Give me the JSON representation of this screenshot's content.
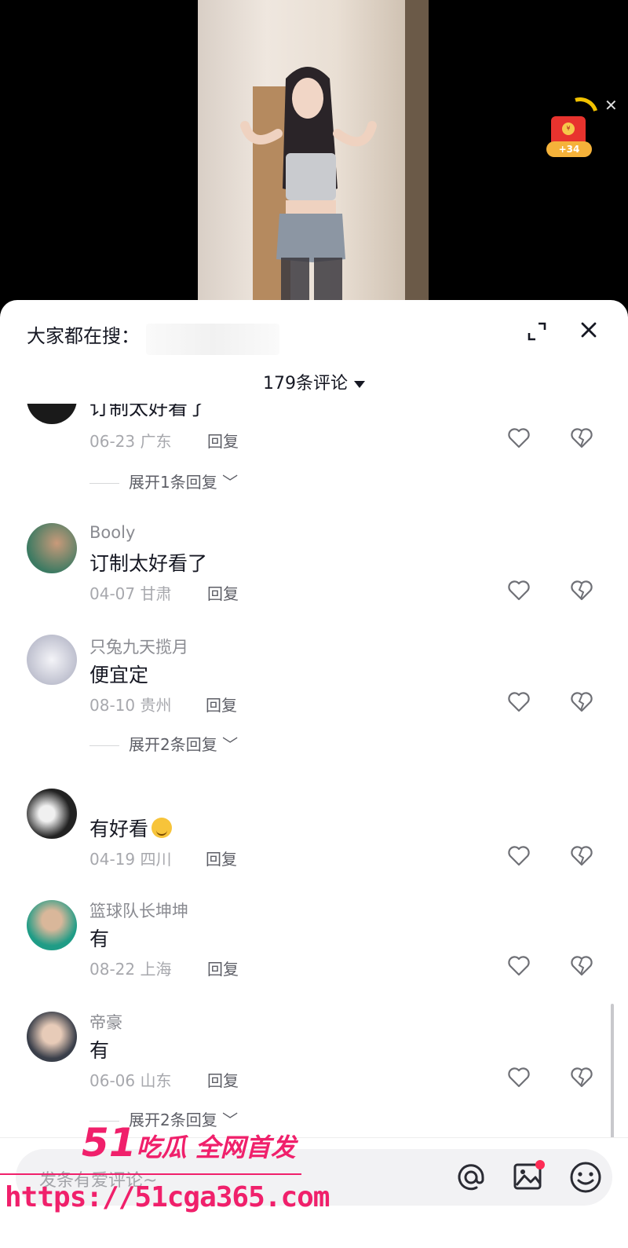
{
  "video": {
    "reward_badge": "+34"
  },
  "sheet": {
    "search_hint": "大家都在搜：",
    "comment_count": "179条评论"
  },
  "comments": [
    {
      "username": "",
      "text": "订制太好看了",
      "date": "06-23",
      "location": "广东",
      "reply_label": "回复",
      "expand_replies": "展开1条回复"
    },
    {
      "username": "Booly",
      "text": "订制太好看了",
      "date": "04-07",
      "location": "甘肃",
      "reply_label": "回复"
    },
    {
      "username": "只兔九天揽月",
      "text": "便宜定",
      "date": "08-10",
      "location": "贵州",
      "reply_label": "回复",
      "expand_replies": "展开2条回复"
    },
    {
      "username": "",
      "text": "有好看",
      "date": "04-19",
      "location": "四川",
      "reply_label": "回复"
    },
    {
      "username": "篮球队长坤坤",
      "text": "有",
      "date": "08-22",
      "location": "上海",
      "reply_label": "回复"
    },
    {
      "username": "帝豪",
      "text": "有",
      "date": "06-06",
      "location": "山东",
      "reply_label": "回复",
      "expand_replies": "展开2条回复"
    }
  ],
  "input": {
    "placeholder": "发条有爱评论~"
  },
  "watermark": {
    "brand_num": "51",
    "brand_text": "吃瓜 全网首发",
    "url": "https://51cga365.com"
  },
  "colors": {
    "accent": "#f0206b",
    "text_primary": "#161823",
    "text_secondary": "#a7a8ad",
    "red_packet": "#e8332e"
  },
  "icons": {
    "expand": "expand-icon",
    "close": "close-icon",
    "like": "heart-icon",
    "dislike": "broken-heart-icon",
    "at": "at-icon",
    "image": "image-icon",
    "emoji": "emoji-icon"
  }
}
